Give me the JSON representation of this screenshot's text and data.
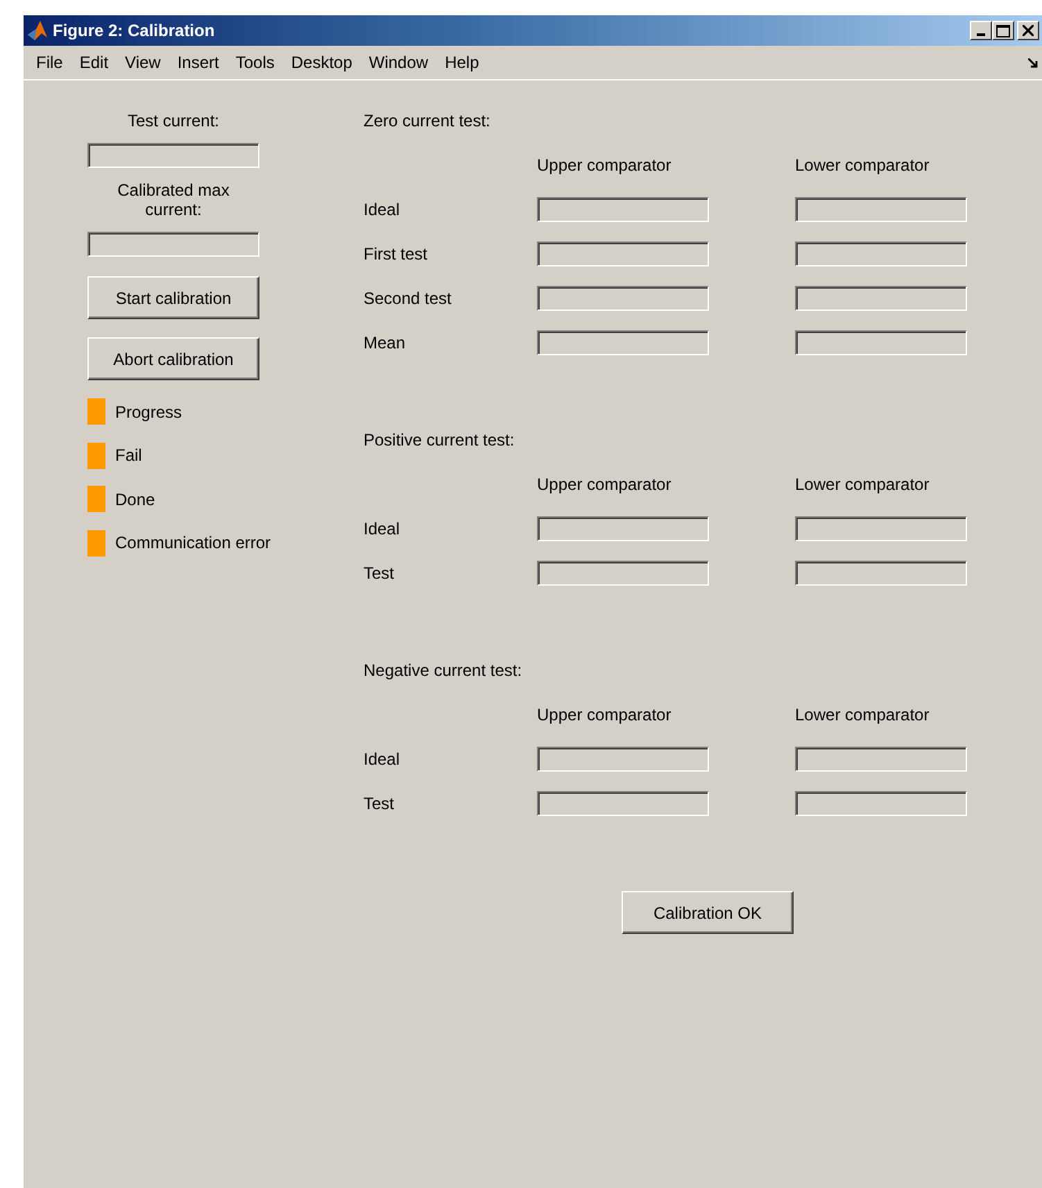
{
  "window": {
    "title": "Figure 2: Calibration"
  },
  "menu": [
    "File",
    "Edit",
    "View",
    "Insert",
    "Tools",
    "Desktop",
    "Window",
    "Help"
  ],
  "left_panel": {
    "test_current_label": "Test current:",
    "max_current_label": "Calibrated max current:",
    "buttons": [
      "Start calibration",
      "Abort calibration"
    ],
    "indicators": [
      {
        "label": "Progress",
        "color": "#ff9900"
      },
      {
        "label": "Fail",
        "color": "#ff9900"
      },
      {
        "label": "Done",
        "color": "#ff9900"
      },
      {
        "label": "Communication error",
        "color": "#ff9900"
      }
    ]
  },
  "sections": [
    {
      "title": "Zero current test:",
      "columns": [
        "Upper comparator",
        "Lower comparator"
      ],
      "rows": [
        "Ideal",
        "First test",
        "Second test",
        "Mean"
      ]
    },
    {
      "title": "Positive current test:",
      "columns": [
        "Upper comparator",
        "Lower comparator"
      ],
      "rows": [
        "Ideal",
        "Test"
      ]
    },
    {
      "title": "Negative current test:",
      "columns": [
        "Upper comparator",
        "Lower comparator"
      ],
      "rows": [
        "Ideal",
        "Test"
      ]
    }
  ],
  "ok_button": "Calibration OK"
}
